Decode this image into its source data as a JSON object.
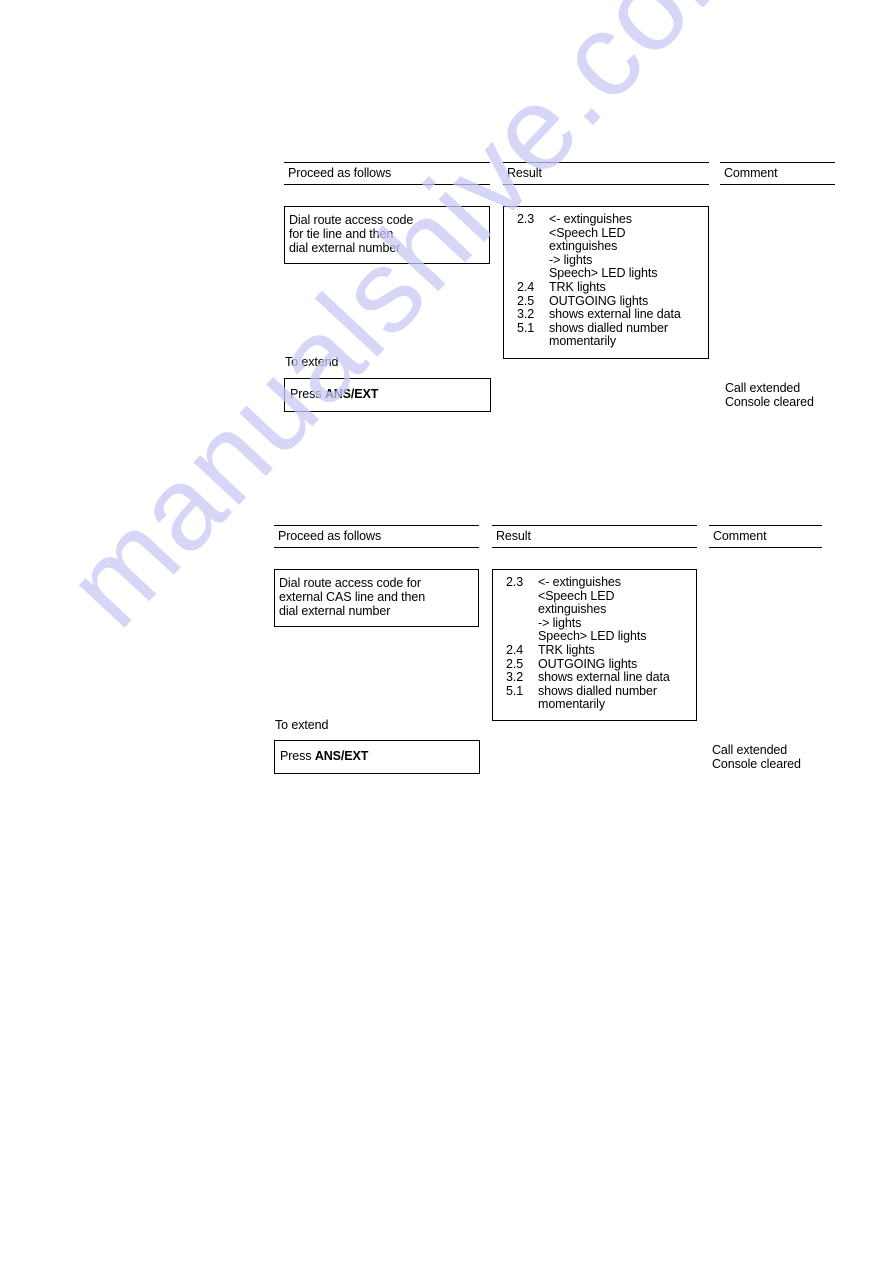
{
  "watermark": {
    "text": "manualshive.com",
    "color": "#c9c9f3"
  },
  "sections": [
    {
      "headers": {
        "proceed": "Proceed as follows",
        "result": "Result",
        "comment": "Comment"
      },
      "instruction": [
        "Dial route access code",
        "for tie line and then",
        "dial external number"
      ],
      "results": [
        {
          "num": "2.3",
          "text": "<- extinguishes"
        },
        {
          "num": "",
          "text": "<Speech LED"
        },
        {
          "num": "",
          "text": "extinguishes"
        },
        {
          "num": "",
          "text": "-> lights"
        },
        {
          "num": "",
          "text": "Speech> LED lights"
        },
        {
          "num": "2.4",
          "text": "TRK lights"
        },
        {
          "num": "2.5",
          "text": "OUTGOING lights"
        },
        {
          "num": "3.2",
          "text": "shows external line data"
        },
        {
          "num": "5.1",
          "text": "shows dialled number"
        },
        {
          "num": "",
          "text": "momentarily"
        }
      ],
      "to_extend": "To extend",
      "press_prefix": "Press",
      "press_key": "ANS/EXT",
      "comment": [
        "Call extended",
        "Console cleared"
      ]
    },
    {
      "headers": {
        "proceed": "Proceed as follows",
        "result": "Result",
        "comment": "Comment"
      },
      "instruction": [
        "Dial route access code for",
        "external CAS line and then",
        "dial external number"
      ],
      "results": [
        {
          "num": "2.3",
          "text": "<- extinguishes"
        },
        {
          "num": "",
          "text": "<Speech LED"
        },
        {
          "num": "",
          "text": "extinguishes"
        },
        {
          "num": "",
          "text": "-> lights"
        },
        {
          "num": "",
          "text": "Speech> LED lights"
        },
        {
          "num": "2.4",
          "text": "TRK lights"
        },
        {
          "num": "2.5",
          "text": "OUTGOING lights"
        },
        {
          "num": "3.2",
          "text": "shows external line data"
        },
        {
          "num": "5.1",
          "text": "shows dialled number"
        },
        {
          "num": "",
          "text": "momentarily"
        }
      ],
      "to_extend": "To extend",
      "press_prefix": "Press",
      "press_key": "ANS/EXT",
      "comment": [
        "Call extended",
        "Console cleared"
      ]
    }
  ]
}
